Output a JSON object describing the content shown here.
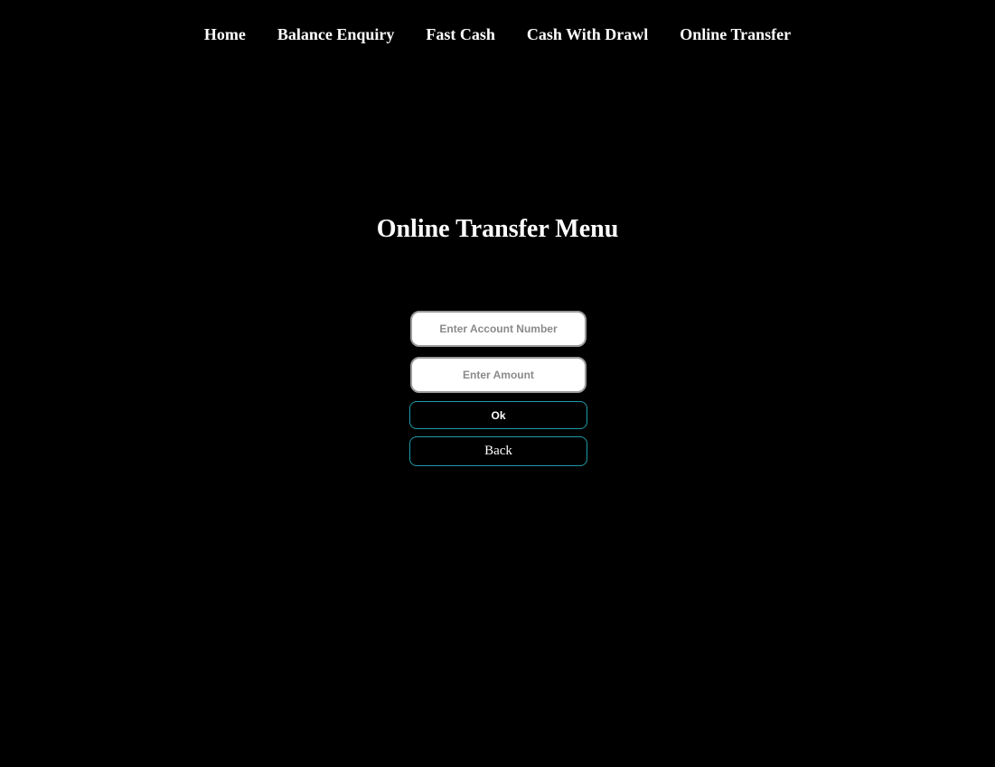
{
  "nav": {
    "items": [
      {
        "label": "Home"
      },
      {
        "label": "Balance Enquiry"
      },
      {
        "label": "Fast Cash"
      },
      {
        "label": "Cash With Drawl"
      },
      {
        "label": "Online Transfer"
      }
    ]
  },
  "main": {
    "title": "Online Transfer Menu",
    "form": {
      "account_number": {
        "placeholder": "Enter Account Number",
        "value": ""
      },
      "amount": {
        "placeholder": "Enter Amount",
        "value": ""
      },
      "ok_label": "Ok",
      "back_label": "Back"
    }
  },
  "colors": {
    "background": "#000000",
    "text": "#ffffff",
    "button_border": "#1e9aa6",
    "input_background": "#ffffff",
    "input_border": "#9a9a9a"
  }
}
